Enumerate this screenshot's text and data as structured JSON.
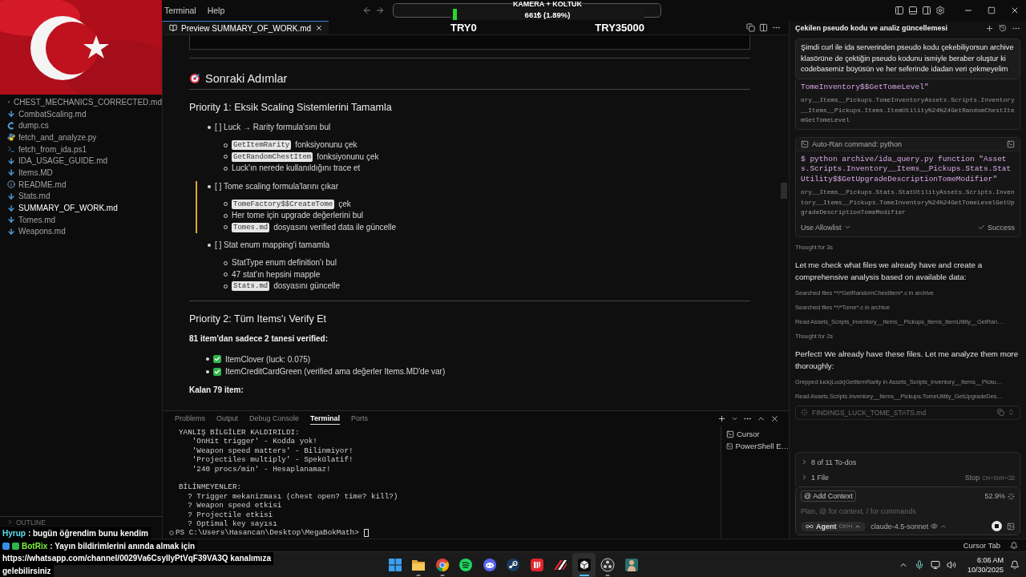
{
  "window": {
    "menus": [
      "Terminal",
      "Help"
    ]
  },
  "overlay": {
    "donation": {
      "title": "KAMERA + KOLTUK",
      "amount": "661₺ (1.89%)",
      "level": 0.0189,
      "min": "TRY0",
      "max": "TRY35000"
    }
  },
  "sidebar": {
    "files": [
      {
        "name": "CHEST_MECHANICS_CORRECTED.md",
        "kind": "markdown",
        "selected": false
      },
      {
        "name": "CombatScaling.md",
        "kind": "markdown",
        "selected": false
      },
      {
        "name": "dump.cs",
        "kind": "csharp",
        "selected": false
      },
      {
        "name": "fetch_and_analyze.py",
        "kind": "python",
        "selected": false
      },
      {
        "name": "fetch_from_ida.ps1",
        "kind": "powershell",
        "selected": false
      },
      {
        "name": "IDA_USAGE_GUIDE.md",
        "kind": "markdown",
        "selected": false
      },
      {
        "name": "Items.MD",
        "kind": "markdown",
        "selected": false
      },
      {
        "name": "README.md",
        "kind": "info",
        "selected": false
      },
      {
        "name": "Stats.md",
        "kind": "markdown",
        "selected": false
      },
      {
        "name": "SUMMARY_OF_WORK.md",
        "kind": "markdown",
        "selected": true
      },
      {
        "name": "Tomes.md",
        "kind": "markdown",
        "selected": false
      },
      {
        "name": "Weapons.md",
        "kind": "markdown",
        "selected": false
      }
    ],
    "outline": "OUTLINE"
  },
  "editor": {
    "tab": {
      "label": "Preview SUMMARY_OF_WORK.md",
      "selected": true
    },
    "document": [
      {
        "kind": "code"
      },
      {
        "kind": "rule"
      },
      {
        "kind": "h2",
        "text": "Sonraki Adımlar",
        "icon": true
      },
      {
        "kind": "h3",
        "text": "Priority 1: Eksik Scaling Sistemlerini Tamamla"
      },
      {
        "kind": "list",
        "items": [
          {
            "text": "[ ] Luck → Rarity formula'sını bul",
            "highlighted": false,
            "children": [
              {
                "code": "GetItemRarity",
                "text": "fonksiyonunu çek"
              },
              {
                "code": "GetRandomChestItem",
                "text": "fonksiyonunu çek"
              },
              {
                "text": "Luck'ın nerede kullanıldığını trace et"
              }
            ]
          },
          {
            "text": "[ ] Tome scaling formula'larını çıkar",
            "highlighted": true,
            "children": [
              {
                "code": "TomeFactory$$CreateTome",
                "text": "çek"
              },
              {
                "text": "Her tome için upgrade değerlerini bul"
              },
              {
                "code": "Tomes.md",
                "text": "dosyasını verified data ile güncelle"
              }
            ]
          },
          {
            "text": "[ ] Stat enum mapping'i tamamla",
            "highlighted": false,
            "children": [
              {
                "text": "StatType enum definition'ı bul"
              },
              {
                "text": "47 stat'ın hepsini mapple"
              },
              {
                "code": "Stats.md",
                "text": "dosyasını güncelle"
              }
            ]
          }
        ]
      },
      {
        "kind": "rule"
      },
      {
        "kind": "h3",
        "text": "Priority 2: Tüm Items'ı Verify Et"
      },
      {
        "kind": "strong",
        "text": "81 item'dan sadece 2 tanesi verified:"
      },
      {
        "kind": "checklist",
        "items": [
          {
            "checked": true,
            "text": "ItemClover (luck: 0.075)"
          },
          {
            "checked": true,
            "text": "ItemCreditCardGreen (verified ama değerler Items.MD'de var)"
          }
        ]
      },
      {
        "kind": "strong",
        "text": "Kalan 79 item:"
      }
    ]
  },
  "panel": {
    "tabs": [
      {
        "label": "Problems",
        "selected": false
      },
      {
        "label": "Output",
        "selected": false
      },
      {
        "label": "Debug Console",
        "selected": false
      },
      {
        "label": "Terminal",
        "selected": true
      },
      {
        "label": "Ports",
        "selected": false
      }
    ],
    "terminal": {
      "blocks": [
        [
          "YANLIŞ BİLGİLER KALDIRILDI:",
          "   'OnHit trigger' - Kodda yok!",
          "   'Weapon speed matters' - Bilinmiyor!",
          "   'Projectiles multiply' - Spekülatif!",
          "   '240 procs/min' - Hesaplanamaz!"
        ],
        [
          "BİLİNMEYENLER:",
          "  ? Trigger mekanizması (chest open? time? kill?)",
          "  ? Weapon speed etkisi",
          "  ? Projectile etkisi",
          "  ? Optimal key sayısı"
        ]
      ],
      "prompt": "PS C:\\Users\\Hasancan\\Desktop\\MegaBokMath>"
    },
    "sessions": [
      "Cursor",
      "PowerShell E…"
    ]
  },
  "agent": {
    "title": "Çekilen pseudo kodu ve analiz güncellemesi",
    "user_message": "Şimdi curl ile ida serverinden pseudo kodu çekebiliyorsun archive klasörüne de çektiğin pseudo kodunu ismiyle beraber oluştur ki codebasemiz büyüsün ve her seferinde idadan veri çekmeyelim",
    "steps": [
      {
        "kind": "command",
        "command": "TomeInventory$$GetTomeLevel\"",
        "output": "ory__Items__Pickups.TomeInventoryAssets.Scripts.Inventory__Items__Pickups.Items.ItemUtility%24%24GetRandomChestItemGetTomeLevel"
      },
      {
        "kind": "command",
        "header": "Auto-Ran command: python",
        "command": "$ python archive/ida_query.py function \"Assets.Scripts.Inventory__Items__Pickups.Stats.StatUtility$$GetUpgradeDescriptionTomeModifier\"",
        "output": "ory__Items__Pickups.Stats.StatUtilityAssets.Scripts.Inventory__Items__Pickups.TomeInventory%24%24GetTomeLevelGetUpgradeDescriptionTomeModifier",
        "allowlist": "Use Allowlist",
        "status": "Success"
      },
      {
        "kind": "note",
        "text": "Thought for 3s"
      },
      {
        "kind": "message",
        "text": "Let me check what files we already have and create a comprehensive analysis based on available data:"
      },
      {
        "kind": "note",
        "text": "Searched files **/*GetRandomChestItem*.c in archive"
      },
      {
        "kind": "note",
        "text": "Searched files **/*Tome*.c in archive"
      },
      {
        "kind": "note",
        "text": "Read Assets_Scripts_Inventory__Items__Pickups_Items_ItemUtility__GetRan…"
      },
      {
        "kind": "note",
        "text": "Thought for 2s"
      },
      {
        "kind": "message",
        "text": "Perfect! We already have these files. Let me analyze them more thoroughly:"
      },
      {
        "kind": "note",
        "text": "Grepped luck|Luck|GetItemRarity in Assets_Scripts_Inventory__Items__Picku…"
      },
      {
        "kind": "note",
        "text": "Read Assets.Scripts.Inventory__Items__Pickups.TomeUtility_GetUpgradeDes…"
      },
      {
        "kind": "file",
        "text": "FINDINGS_LUCK_TOME_STATS.md"
      }
    ],
    "todos": [
      "8 of 11 To-dos",
      "1 File"
    ],
    "stop": "Stop",
    "stop_shortcut": "Ctrl+Shift+⌫",
    "composer": {
      "add_context": "@ Add Context",
      "usage": "52.9%",
      "placeholder": "Plan, @ for context, / for commands",
      "mode": "Agent",
      "mode_shortcut": "Ctrl+I",
      "model": "claude-4.5-sonnet"
    }
  },
  "chat": [
    {
      "user": "Hyrup",
      "color": "#5fe0f0",
      "badges": false,
      "lines": [
        ": bugün öğrendim bunu kendim"
      ]
    },
    {
      "user": "BotRix",
      "color": "#7cf53c",
      "badges": true,
      "lines": [
        ": Yayın bildirimlerini anında almak için",
        "https://whatsapp.com/channel/0029Va6CsyIlyPtVqF39VA3Q kanalımıza",
        "gelebilirsiniz"
      ]
    }
  ],
  "status_bar": {
    "items": [
      "Cursor Tab"
    ]
  },
  "taskbar": {
    "apps": [
      {
        "kind": "start",
        "running": false,
        "selected": false
      },
      {
        "kind": "folder",
        "running": true,
        "selected": false
      },
      {
        "kind": "browser",
        "running": true,
        "selected": false
      },
      {
        "kind": "music",
        "running": false,
        "selected": false
      },
      {
        "kind": "chat",
        "running": false,
        "selected": false
      },
      {
        "kind": "launcher",
        "running": false,
        "selected": false
      },
      {
        "kind": "game",
        "running": false,
        "selected": false
      },
      {
        "kind": "stripes",
        "running": false,
        "selected": false
      },
      {
        "kind": "editor",
        "running": true,
        "selected": true
      },
      {
        "kind": "recorder",
        "running": true,
        "selected": false
      },
      {
        "kind": "figure",
        "running": false,
        "selected": false
      }
    ],
    "time": "6:06 AM",
    "date": "10/30/2025"
  }
}
